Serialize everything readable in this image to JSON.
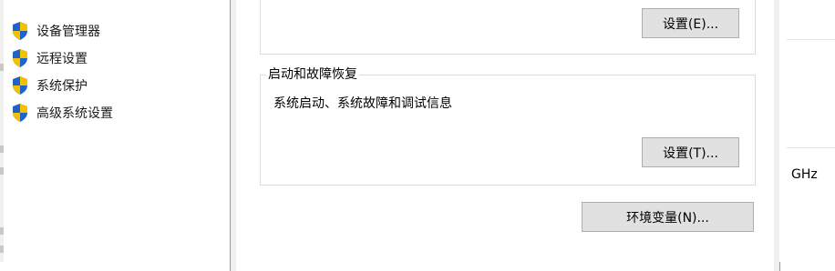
{
  "left_panel": {
    "links": [
      {
        "label": "设备管理器"
      },
      {
        "label": "远程设置"
      },
      {
        "label": "系统保护"
      },
      {
        "label": "高级系统设置"
      }
    ]
  },
  "dialog": {
    "top_group": {
      "button_label": "设置(E)..."
    },
    "startup_group": {
      "title": "启动和故障恢复",
      "description": "系统启动、系统故障和调试信息",
      "button_label": "设置(T)..."
    },
    "env_button_label": "环境变量(N)..."
  },
  "right_panel": {
    "cpu_unit": "GHz"
  },
  "colors": {
    "shield_blue": "#1e64c8",
    "shield_yellow": "#f2c200",
    "button_face": "#e1e1e1",
    "button_border": "#adadad"
  }
}
